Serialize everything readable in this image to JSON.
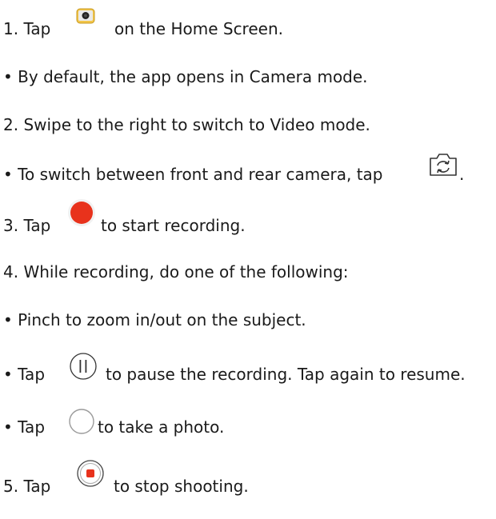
{
  "steps": {
    "l1a": "1. Tap",
    "l1b": "on the Home Screen.",
    "l2": "• By default, the app opens in Camera mode.",
    "l3": "2. Swipe to the right to switch to Video mode.",
    "l4a": "• To switch between front and rear camera, tap",
    "l4b": ".",
    "l5a": "3. Tap",
    "l5b": "to start recording.",
    "l6": "4. While recording, do one of the following:",
    "l7": "• Pinch to zoom in/out on the subject.",
    "l8a": "• Tap",
    "l8b": "to pause the recording. Tap again to resume.",
    "l9a": "• Tap",
    "l9b": "to take a photo.",
    "l10a": "5. Tap",
    "l10b": "to stop shooting."
  },
  "icons": {
    "camera_app": "camera-app-icon",
    "switch_camera": "switch-camera-icon",
    "record": "record-button-icon",
    "pause": "pause-button-icon",
    "capture": "photo-capture-button-icon",
    "stop": "stop-button-icon"
  },
  "colors": {
    "text": "#1a1a1a",
    "record_red": "#e8321c",
    "camera_app_yellow": "#f3c64a"
  }
}
